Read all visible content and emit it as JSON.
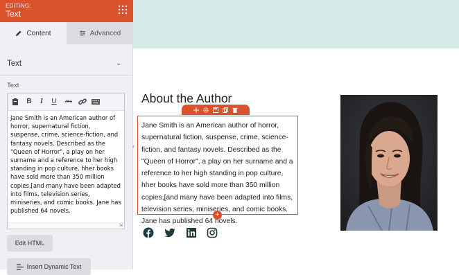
{
  "sidebar": {
    "header": {
      "editing_label": "EDITING:",
      "title": "Text",
      "grip_icon": "grid-dots-icon"
    },
    "tabs": [
      {
        "label": "Content",
        "icon": "pencil-icon",
        "active": true
      },
      {
        "label": "Advanced",
        "icon": "sliders-icon",
        "active": false
      }
    ],
    "section_title": "Text",
    "field_label": "Text",
    "toolbar": [
      "paste-icon",
      "bold-icon",
      "italic-icon",
      "underline-icon",
      "strikethrough-icon",
      "link-icon",
      "keyboard-icon"
    ],
    "toolbar_labels": {
      "bold": "B",
      "italic": "I",
      "underline": "U",
      "strike": "ABC"
    },
    "editor_text": "Jane Smith is an American author of horror, supernatural fiction, suspense, crime, science-fiction, and fantasy novels. Described as the \"Queen of Horror\", a play on her surname and a reference to her high standing in pop culture, hher books have sold more than 350 million copies,[and many have been adapted into films, television series, miniseries, and comic books. Jane has published 64 novels.",
    "edit_html_label": "Edit HTML",
    "dynamic_text_label": "Insert Dynamic Text"
  },
  "canvas": {
    "heading": "About the Author",
    "bio": "Jane Smith is an American author of horror, supernatural fiction, suspense, crime, science-fiction, and fantasy novels. Described as the \"Queen of Horror\", a play on her surname and a reference to her high standing in pop culture, hher books have sold more than 350 million copies,[and many have been adapted into films, television series, miniseries, and comic books. Jane has published 64 novels.",
    "block_toolbar": [
      "move-icon",
      "settings-icon",
      "save-icon",
      "duplicate-icon",
      "delete-icon"
    ],
    "social": [
      "facebook-icon",
      "twitter-icon",
      "linkedin-icon",
      "instagram-icon"
    ]
  },
  "colors": {
    "accent": "#d9522c",
    "banner": "#d5ebea",
    "sidebar_bg": "#f0eff4"
  }
}
